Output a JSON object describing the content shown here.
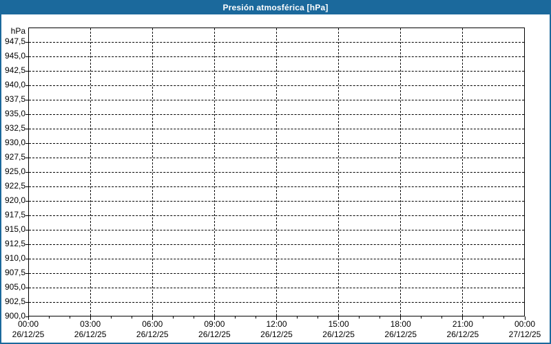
{
  "window": {
    "title": "Presión atmosférica [hPa]"
  },
  "colors": {
    "titlebar_bg": "#1b699c",
    "outer_border": "#1b699c",
    "title_text": "#ffffff",
    "axis_text": "#000000",
    "gridline": "#000000",
    "background": "#ffffff"
  },
  "chart_data": {
    "type": "line",
    "title": "Presión atmosférica [hPa]",
    "y_unit_label": "hPa",
    "xlabel": "",
    "ylabel": "",
    "ylim": [
      900,
      950
    ],
    "ytick_step": 2.5,
    "x_range_hours": [
      0,
      24
    ],
    "x_major_tick_hours": 3,
    "x_minor_tick_hours": 1,
    "grid": "dashed",
    "legend": "none",
    "series": [],
    "yticks": [
      {
        "value": 947.5,
        "label": "947,5"
      },
      {
        "value": 945.0,
        "label": "945,0"
      },
      {
        "value": 942.5,
        "label": "942,5"
      },
      {
        "value": 940.0,
        "label": "940,0"
      },
      {
        "value": 937.5,
        "label": "937,5"
      },
      {
        "value": 935.0,
        "label": "935,0"
      },
      {
        "value": 932.5,
        "label": "932,5"
      },
      {
        "value": 930.0,
        "label": "930,0"
      },
      {
        "value": 927.5,
        "label": "927,5"
      },
      {
        "value": 925.0,
        "label": "925,0"
      },
      {
        "value": 922.5,
        "label": "922,5"
      },
      {
        "value": 920.0,
        "label": "920,0"
      },
      {
        "value": 917.5,
        "label": "917,5"
      },
      {
        "value": 915.0,
        "label": "915,0"
      },
      {
        "value": 912.5,
        "label": "912,5"
      },
      {
        "value": 910.0,
        "label": "910,0"
      },
      {
        "value": 907.5,
        "label": "907,5"
      },
      {
        "value": 905.0,
        "label": "905,0"
      },
      {
        "value": 902.5,
        "label": "902,5"
      },
      {
        "value": 900.0,
        "label": "900,0"
      }
    ],
    "xticks": [
      {
        "hour": 0,
        "time": "00:00",
        "date": "26/12/25"
      },
      {
        "hour": 3,
        "time": "03:00",
        "date": "26/12/25"
      },
      {
        "hour": 6,
        "time": "06:00",
        "date": "26/12/25"
      },
      {
        "hour": 9,
        "time": "09:00",
        "date": "26/12/25"
      },
      {
        "hour": 12,
        "time": "12:00",
        "date": "26/12/25"
      },
      {
        "hour": 15,
        "time": "15:00",
        "date": "26/12/25"
      },
      {
        "hour": 18,
        "time": "18:00",
        "date": "26/12/25"
      },
      {
        "hour": 21,
        "time": "21:00",
        "date": "26/12/25"
      },
      {
        "hour": 24,
        "time": "00:00",
        "date": "27/12/25"
      }
    ]
  }
}
